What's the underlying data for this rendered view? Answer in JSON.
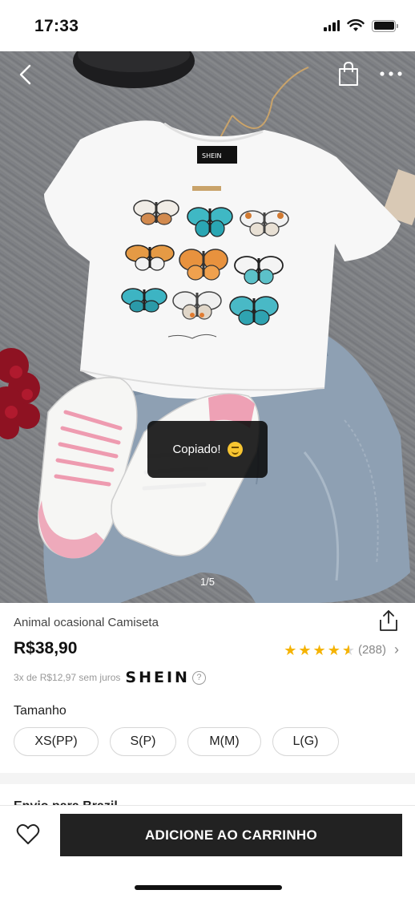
{
  "status_bar": {
    "time": "17:33"
  },
  "gallery": {
    "pager": "1/5",
    "toast_text": "Copiado!",
    "icons": [
      "back-arrow-icon",
      "shopping-bag-icon",
      "more-dots-icon"
    ]
  },
  "product": {
    "title": "Animal ocasional Camiseta",
    "price": "R$38,90",
    "rating_stars": 4.5,
    "rating_count": "(288)",
    "installments": "3x de R$12,97 sem juros",
    "brand": "SHEIN",
    "help_symbol": "?"
  },
  "size": {
    "label": "Tamanho",
    "options": [
      "XS(PP)",
      "S(P)",
      "M(M)",
      "L(G)"
    ]
  },
  "shipping": {
    "heading": "Envio para Brazil"
  },
  "bottom_bar": {
    "add_to_cart_label": "ADICIONE AO CARRINHO"
  },
  "colors": {
    "button_dark": "#222222",
    "star": "#f5b301",
    "toast_bg": "#0a0a0a"
  }
}
